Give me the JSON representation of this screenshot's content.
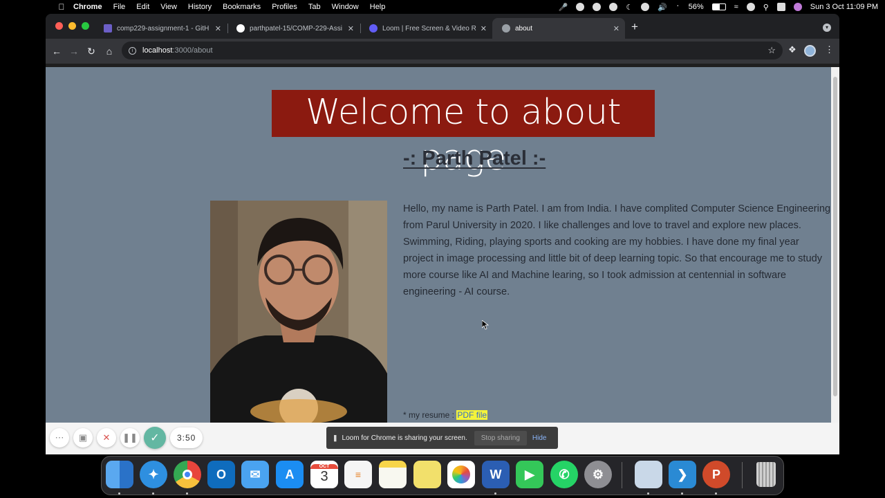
{
  "menubar": {
    "app_name": "Chrome",
    "menus": [
      "File",
      "Edit",
      "View",
      "History",
      "Bookmarks",
      "Profiles",
      "Tab",
      "Window",
      "Help"
    ],
    "battery": "56%",
    "datetime": "Sun 3 Oct  11:09 PM"
  },
  "tabs": [
    {
      "title": "comp229-assignment-1 - GitH",
      "favicon_color": "#6c5fc7"
    },
    {
      "title": "parthpatel-15/COMP-229-Assi",
      "favicon_color": "#ffffff"
    },
    {
      "title": "Loom | Free Screen & Video Re",
      "favicon_color": "#625df5"
    },
    {
      "title": "about",
      "favicon_color": "#9aa0a6"
    }
  ],
  "address_bar": {
    "host": "localhost",
    "path": ":3000/about"
  },
  "page": {
    "title": "Welcome to about page",
    "subtitle": "-: Parth Patel :-",
    "bio": "Hello, my name is Parth Patel. I am from India. I have complited Computer Science Engineering from Parul University in 2020. I like challenges and love to travel and explore new places. Swimming, Riding, playing sports and cooking are my hobbies. I have done my final year project in image processing and little bit of deep learning topic. So that encourage me to study more course like AI and Machine learing, so I took admission at centennial in software engineering - AI course.",
    "resume_label": "* my resume : ",
    "resume_link": "PDF file",
    "colors": {
      "background": "#708090",
      "title_bg": "#8b1a10",
      "link_highlight": "#f3f33a"
    }
  },
  "loom": {
    "timer": "3:50",
    "share_text": "Loom for Chrome is sharing your screen.",
    "stop_label": "Stop sharing",
    "hide_label": "Hide"
  },
  "dock": {
    "apps": [
      {
        "name": "Finder",
        "icon": "finder-icon",
        "color": "#3a8ee6"
      },
      {
        "name": "Safari",
        "icon": "safari-icon",
        "color": "#2e8fe0"
      },
      {
        "name": "Chrome",
        "icon": "chrome-icon",
        "color": "#e8453c"
      },
      {
        "name": "Outlook",
        "icon": "outlook-icon",
        "color": "#0f6cbd"
      },
      {
        "name": "Mail",
        "icon": "mail-icon",
        "color": "#4aa3f0"
      },
      {
        "name": "App Store",
        "icon": "app-store-icon",
        "color": "#1b8df2"
      },
      {
        "name": "Calendar",
        "icon": "calendar-icon",
        "color": "#ffffff"
      },
      {
        "name": "Reminders",
        "icon": "reminders-icon",
        "color": "#f5f5f5"
      },
      {
        "name": "Notes",
        "icon": "notes-icon",
        "color": "#f7d54a"
      },
      {
        "name": "Stickies",
        "icon": "stickies-icon",
        "color": "#f2e06b"
      },
      {
        "name": "Photos",
        "icon": "photos-icon",
        "color": "#ffffff"
      },
      {
        "name": "Word",
        "icon": "word-icon",
        "color": "#2b5eb3"
      },
      {
        "name": "FaceTime",
        "icon": "facetime-icon",
        "color": "#34c759"
      },
      {
        "name": "WhatsApp",
        "icon": "whatsapp-icon",
        "color": "#25d366"
      },
      {
        "name": "System Preferences",
        "icon": "system-preferences-icon",
        "color": "#8e8e93"
      },
      {
        "name": "Preview",
        "icon": "preview-icon",
        "color": "#c9d8e8"
      },
      {
        "name": "VS Code",
        "icon": "vscode-icon",
        "color": "#2a8ad4"
      },
      {
        "name": "PowerPoint",
        "icon": "powerpoint-icon",
        "color": "#d04a2a"
      },
      {
        "name": "Trash",
        "icon": "trash-icon",
        "color": "#b5b5b5"
      }
    ],
    "calendar_month": "OCT",
    "calendar_day": "3"
  }
}
